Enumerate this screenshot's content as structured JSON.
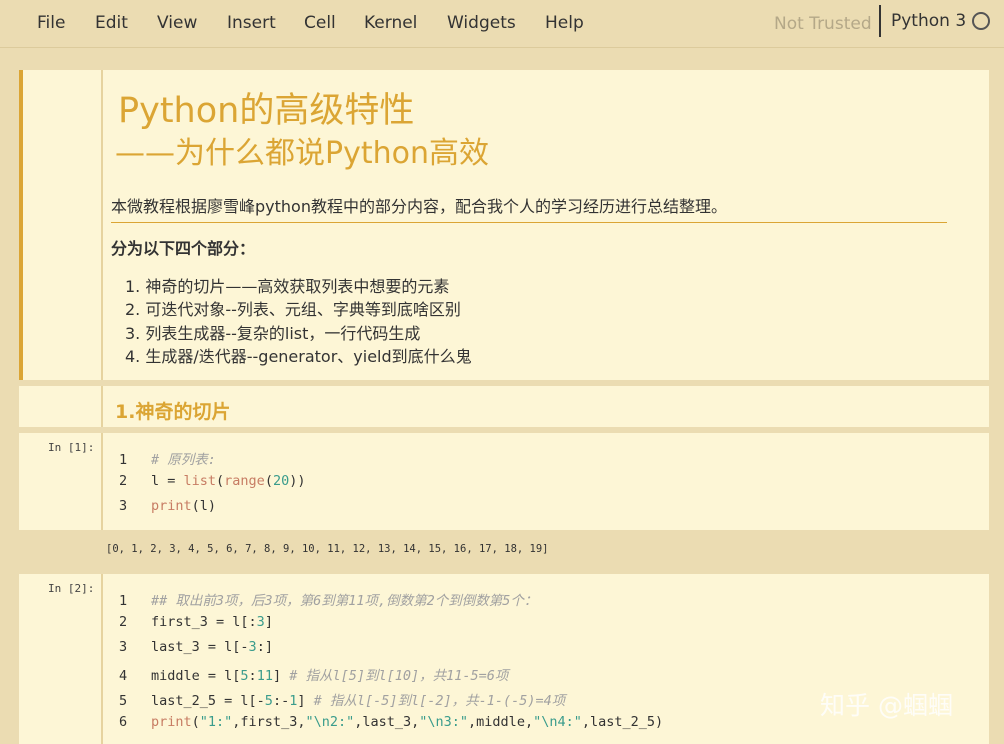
{
  "menu": {
    "items": [
      "File",
      "Edit",
      "View",
      "Insert",
      "Cell",
      "Kernel",
      "Widgets",
      "Help"
    ],
    "trust_status": "Not Trusted",
    "kernel": "Python 3"
  },
  "cells": {
    "intro": {
      "title": "Python的高级特性",
      "subtitle": "——为什么都说Python高效",
      "description": "本微教程根据廖雪峰python教程中的部分内容，配合我个人的学习经历进行总结整理。",
      "section_heading": "分为以下四个部分：",
      "list": [
        "1. 神奇的切片——高效获取列表中想要的元素",
        "2. 可迭代对象--列表、元组、字典等到底啥区别",
        "3. 列表生成器--复杂的list，一行代码生成",
        "4. 生成器/迭代器--generator、yield到底什么鬼"
      ]
    },
    "heading1": "1.神奇的切片",
    "code1": {
      "prompt": "In  [1]:",
      "ln": [
        "1",
        "2",
        "3"
      ],
      "line1": "# 原列表:",
      "line2_a": "l = ",
      "line2_b": "list",
      "line2_c": "(",
      "line2_d": "range",
      "line2_e": "(",
      "line2_f": "20",
      "line2_g": "))",
      "line3_a": "print",
      "line3_b": "(l)",
      "output": "[0, 1, 2, 3, 4, 5, 6, 7, 8, 9, 10, 11, 12, 13, 14, 15, 16, 17, 18, 19]"
    },
    "code2": {
      "prompt": "In  [2]:",
      "ln": [
        "1",
        "2",
        "3",
        "4",
        "5",
        "6"
      ],
      "line1": "## 取出前3项，后3项，第6到第11项,倒数第2个到倒数第5个：",
      "line2_a": "first_3 = l[:",
      "line2_b": "3",
      "line2_c": "]",
      "line3_a": "last_3 = l[-",
      "line3_b": "3",
      "line3_c": ":]",
      "line4_a": "middle = l[",
      "line4_b": "5",
      "line4_c": ":",
      "line4_d": "11",
      "line4_e": "] ",
      "line4_f": "# 指从l[5]到l[10]，共11-5=6项",
      "line5_a": "last_2_5 = l[-",
      "line5_b": "5",
      "line5_c": ":-",
      "line5_d": "1",
      "line5_e": "] ",
      "line5_f": "# 指从l[-5]到l[-2]，共-1-(-5)=4项",
      "line6_a": "print",
      "line6_b": "(",
      "line6_c": "\"1:\"",
      "line6_d": ",first_3,",
      "line6_e": "\"\\n2:\"",
      "line6_f": ",last_3,",
      "line6_g": "\"\\n3:\"",
      "line6_h": ",middle,",
      "line6_i": "\"\\n4:\"",
      "line6_j": ",last_2_5)"
    }
  },
  "watermark": "知乎 @蝈蝈"
}
